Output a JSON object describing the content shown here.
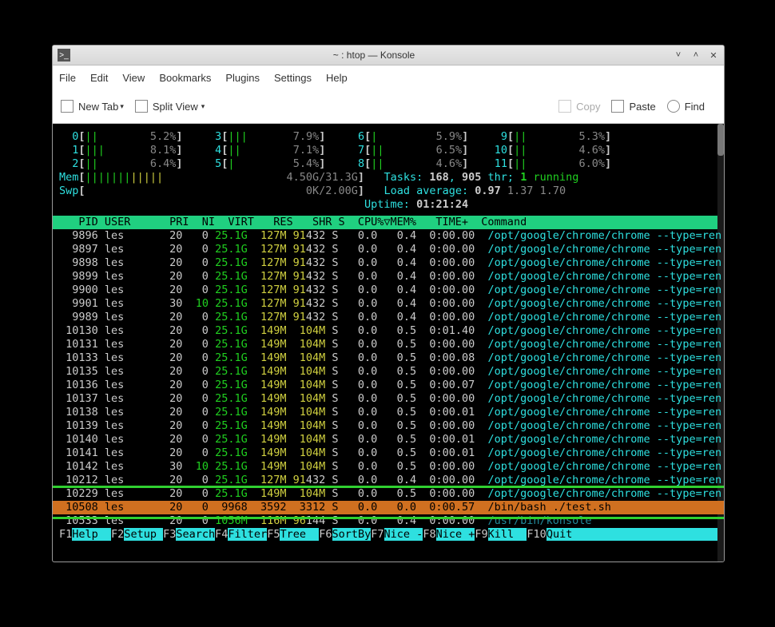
{
  "window": {
    "title": "~ : htop — Konsole"
  },
  "menubar": [
    "File",
    "Edit",
    "View",
    "Bookmarks",
    "Plugins",
    "Settings",
    "Help"
  ],
  "toolbar": {
    "new_tab": "New Tab",
    "split_view": "Split View",
    "copy": "Copy",
    "paste": "Paste",
    "find": "Find"
  },
  "cpus": [
    {
      "id": "0",
      "bar": "||",
      "pct": "5.2%"
    },
    {
      "id": "1",
      "bar": "|||",
      "pct": "8.1%"
    },
    {
      "id": "2",
      "bar": "||",
      "pct": "6.4%"
    },
    {
      "id": "3",
      "bar": "|||",
      "pct": "7.9%"
    },
    {
      "id": "4",
      "bar": "||",
      "pct": "7.1%"
    },
    {
      "id": "5",
      "bar": "|",
      "pct": "5.4%"
    },
    {
      "id": "6",
      "bar": "|",
      "pct": "5.9%"
    },
    {
      "id": "7",
      "bar": "||",
      "pct": "6.5%"
    },
    {
      "id": "8",
      "bar": "||",
      "pct": "4.6%"
    },
    {
      "id": "9",
      "bar": "||",
      "pct": "5.3%"
    },
    {
      "id": "10",
      "bar": "||",
      "pct": "4.6%"
    },
    {
      "id": "11",
      "bar": "||",
      "pct": "6.0%"
    }
  ],
  "mem": {
    "label": "Mem",
    "bars_green": "|||||||",
    "bars_yellow": "|||||",
    "val": "4.50G/31.3G"
  },
  "swp": {
    "label": "Swp",
    "val": "0K/2.00G"
  },
  "tasks": {
    "label": "Tasks:",
    "total": "168",
    "threads": "905",
    "thr": "thr;",
    "running_n": "1",
    "running": "running"
  },
  "load": {
    "label": "Load average:",
    "v1": "0.97",
    "v2": "1.37",
    "v3": "1.70"
  },
  "uptime": {
    "label": "Uptime:",
    "val": "01:21:24"
  },
  "header": "   PID USER      PRI  NI  VIRT   RES   SHR S  CPU%▽MEM%   TIME+  Command",
  "rows": [
    {
      "pid": " 9896",
      "user": "les",
      "pri": "20",
      "ni": "  0",
      "virt": "25.1G",
      "res": " 127M",
      "shr": "91432",
      "s": "S",
      "cpu": "  0.0",
      "mem": "  0.4",
      "time": " 0:00.00",
      "cmd": "/opt/google/chrome/chrome --type=ren",
      "shr_hi": "91"
    },
    {
      "pid": " 9897",
      "user": "les",
      "pri": "20",
      "ni": "  0",
      "virt": "25.1G",
      "res": " 127M",
      "shr": "91432",
      "s": "S",
      "cpu": "  0.0",
      "mem": "  0.4",
      "time": " 0:00.00",
      "cmd": "/opt/google/chrome/chrome --type=ren",
      "shr_hi": "91"
    },
    {
      "pid": " 9898",
      "user": "les",
      "pri": "20",
      "ni": "  0",
      "virt": "25.1G",
      "res": " 127M",
      "shr": "91432",
      "s": "S",
      "cpu": "  0.0",
      "mem": "  0.4",
      "time": " 0:00.00",
      "cmd": "/opt/google/chrome/chrome --type=ren",
      "shr_hi": "91"
    },
    {
      "pid": " 9899",
      "user": "les",
      "pri": "20",
      "ni": "  0",
      "virt": "25.1G",
      "res": " 127M",
      "shr": "91432",
      "s": "S",
      "cpu": "  0.0",
      "mem": "  0.4",
      "time": " 0:00.00",
      "cmd": "/opt/google/chrome/chrome --type=ren",
      "shr_hi": "91"
    },
    {
      "pid": " 9900",
      "user": "les",
      "pri": "20",
      "ni": "  0",
      "virt": "25.1G",
      "res": " 127M",
      "shr": "91432",
      "s": "S",
      "cpu": "  0.0",
      "mem": "  0.4",
      "time": " 0:00.00",
      "cmd": "/opt/google/chrome/chrome --type=ren",
      "shr_hi": "91"
    },
    {
      "pid": " 9901",
      "user": "les",
      "pri": "30",
      "ni": " 10",
      "virt": "25.1G",
      "res": " 127M",
      "shr": "91432",
      "s": "S",
      "cpu": "  0.0",
      "mem": "  0.4",
      "time": " 0:00.00",
      "cmd": "/opt/google/chrome/chrome --type=ren",
      "shr_hi": "91",
      "ni_hi": true
    },
    {
      "pid": " 9989",
      "user": "les",
      "pri": "20",
      "ni": "  0",
      "virt": "25.1G",
      "res": " 127M",
      "shr": "91432",
      "s": "S",
      "cpu": "  0.0",
      "mem": "  0.4",
      "time": " 0:00.00",
      "cmd": "/opt/google/chrome/chrome --type=ren",
      "shr_hi": "91"
    },
    {
      "pid": "10130",
      "user": "les",
      "pri": "20",
      "ni": "  0",
      "virt": "25.1G",
      "res": " 149M",
      "shr": " 104M",
      "s": "S",
      "cpu": "  0.0",
      "mem": "  0.5",
      "time": " 0:01.40",
      "cmd": "/opt/google/chrome/chrome --type=ren"
    },
    {
      "pid": "10131",
      "user": "les",
      "pri": "20",
      "ni": "  0",
      "virt": "25.1G",
      "res": " 149M",
      "shr": " 104M",
      "s": "S",
      "cpu": "  0.0",
      "mem": "  0.5",
      "time": " 0:00.00",
      "cmd": "/opt/google/chrome/chrome --type=ren"
    },
    {
      "pid": "10133",
      "user": "les",
      "pri": "20",
      "ni": "  0",
      "virt": "25.1G",
      "res": " 149M",
      "shr": " 104M",
      "s": "S",
      "cpu": "  0.0",
      "mem": "  0.5",
      "time": " 0:00.08",
      "cmd": "/opt/google/chrome/chrome --type=ren"
    },
    {
      "pid": "10135",
      "user": "les",
      "pri": "20",
      "ni": "  0",
      "virt": "25.1G",
      "res": " 149M",
      "shr": " 104M",
      "s": "S",
      "cpu": "  0.0",
      "mem": "  0.5",
      "time": " 0:00.00",
      "cmd": "/opt/google/chrome/chrome --type=ren"
    },
    {
      "pid": "10136",
      "user": "les",
      "pri": "20",
      "ni": "  0",
      "virt": "25.1G",
      "res": " 149M",
      "shr": " 104M",
      "s": "S",
      "cpu": "  0.0",
      "mem": "  0.5",
      "time": " 0:00.07",
      "cmd": "/opt/google/chrome/chrome --type=ren"
    },
    {
      "pid": "10137",
      "user": "les",
      "pri": "20",
      "ni": "  0",
      "virt": "25.1G",
      "res": " 149M",
      "shr": " 104M",
      "s": "S",
      "cpu": "  0.0",
      "mem": "  0.5",
      "time": " 0:00.00",
      "cmd": "/opt/google/chrome/chrome --type=ren"
    },
    {
      "pid": "10138",
      "user": "les",
      "pri": "20",
      "ni": "  0",
      "virt": "25.1G",
      "res": " 149M",
      "shr": " 104M",
      "s": "S",
      "cpu": "  0.0",
      "mem": "  0.5",
      "time": " 0:00.01",
      "cmd": "/opt/google/chrome/chrome --type=ren"
    },
    {
      "pid": "10139",
      "user": "les",
      "pri": "20",
      "ni": "  0",
      "virt": "25.1G",
      "res": " 149M",
      "shr": " 104M",
      "s": "S",
      "cpu": "  0.0",
      "mem": "  0.5",
      "time": " 0:00.00",
      "cmd": "/opt/google/chrome/chrome --type=ren"
    },
    {
      "pid": "10140",
      "user": "les",
      "pri": "20",
      "ni": "  0",
      "virt": "25.1G",
      "res": " 149M",
      "shr": " 104M",
      "s": "S",
      "cpu": "  0.0",
      "mem": "  0.5",
      "time": " 0:00.01",
      "cmd": "/opt/google/chrome/chrome --type=ren"
    },
    {
      "pid": "10141",
      "user": "les",
      "pri": "20",
      "ni": "  0",
      "virt": "25.1G",
      "res": " 149M",
      "shr": " 104M",
      "s": "S",
      "cpu": "  0.0",
      "mem": "  0.5",
      "time": " 0:00.01",
      "cmd": "/opt/google/chrome/chrome --type=ren"
    },
    {
      "pid": "10142",
      "user": "les",
      "pri": "30",
      "ni": " 10",
      "virt": "25.1G",
      "res": " 149M",
      "shr": " 104M",
      "s": "S",
      "cpu": "  0.0",
      "mem": "  0.5",
      "time": " 0:00.00",
      "cmd": "/opt/google/chrome/chrome --type=ren",
      "ni_hi": true
    },
    {
      "pid": "10212",
      "user": "les",
      "pri": "20",
      "ni": "  0",
      "virt": "25.1G",
      "res": " 127M",
      "shr": "91432",
      "s": "S",
      "cpu": "  0.0",
      "mem": "  0.4",
      "time": " 0:00.00",
      "cmd": "/opt/google/chrome/chrome --type=ren",
      "shr_hi": "91"
    },
    {
      "pid": "10229",
      "user": "les",
      "pri": "20",
      "ni": "  0",
      "virt": "25.1G",
      "res": " 149M",
      "shr": " 104M",
      "s": "S",
      "cpu": "  0.0",
      "mem": "  0.5",
      "time": " 0:00.00",
      "cmd": "/opt/google/chrome/chrome --type=ren"
    },
    {
      "pid": "10508",
      "user": "les",
      "pri": "20",
      "ni": "  0",
      "virt": " 9968",
      "res": " 3592",
      "shr": " 3312",
      "s": "S",
      "cpu": "  0.0",
      "mem": "  0.0",
      "time": " 0:00.57",
      "cmd": "/bin/bash ./test.sh",
      "selected": true
    },
    {
      "pid": "10533",
      "user": "les",
      "pri": "20",
      "ni": "  0",
      "virt": "1056M",
      "res": " 116M",
      "shr": "96144",
      "s": "S",
      "cpu": "  0.0",
      "mem": "  0.4",
      "time": " 0:00.00",
      "cmd": "/usr/bin/konsole",
      "shr_hi": "96",
      "partial": true
    }
  ],
  "footer": [
    {
      "k": "F1",
      "l": "Help  "
    },
    {
      "k": "F2",
      "l": "Setup "
    },
    {
      "k": "F3",
      "l": "Search"
    },
    {
      "k": "F4",
      "l": "Filter"
    },
    {
      "k": "F5",
      "l": "Tree  "
    },
    {
      "k": "F6",
      "l": "SortBy"
    },
    {
      "k": "F7",
      "l": "Nice -"
    },
    {
      "k": "F8",
      "l": "Nice +"
    },
    {
      "k": "F9",
      "l": "Kill  "
    },
    {
      "k": "F10",
      "l": "Quit  "
    }
  ]
}
